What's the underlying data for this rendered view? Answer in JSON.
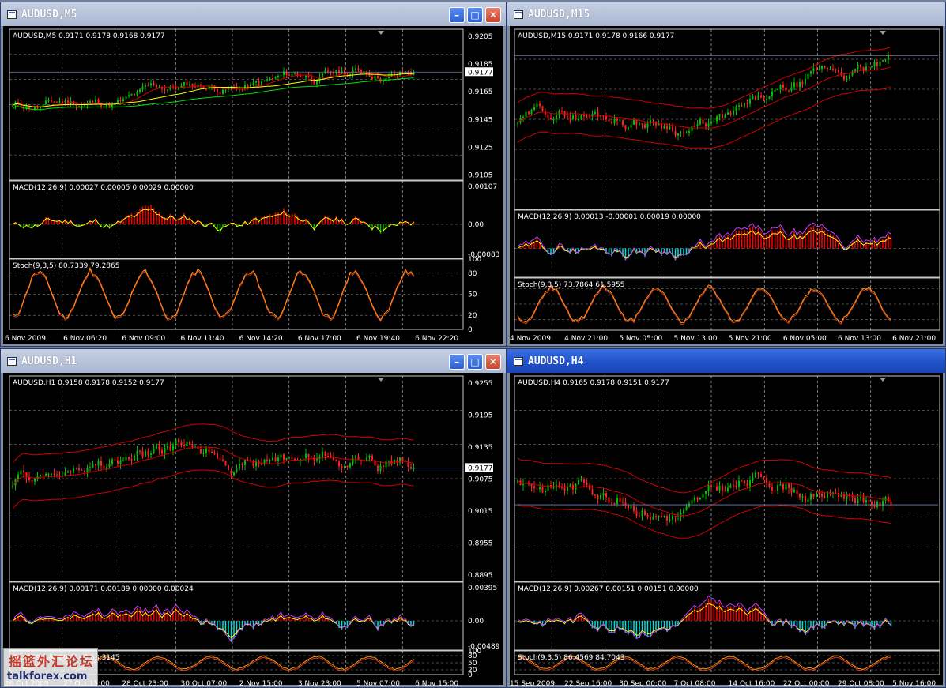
{
  "windows": [
    {
      "title": "AUDUSD,M5",
      "active": false,
      "show_buttons": true,
      "price_header": "AUDUSD,M5  0.9171 0.9178 0.9168 0.9177",
      "current_price": "0.9177",
      "price_ticks": [
        "0.9205",
        "0.9185",
        "0.9165",
        "0.9145",
        "0.9125",
        "0.9105"
      ],
      "macd_header": "MACD(12,26,9) 0.00027 0.00005 0.00029 0.00000",
      "macd_ticks": [
        "0.00107",
        "0.00",
        "-0.00083"
      ],
      "stoch_header": "Stoch(9,3,5) 80.7339 79.2865",
      "stoch_ticks": [
        "100",
        "80",
        "50",
        "20",
        "0"
      ],
      "time_labels": [
        "6 Nov 2009",
        "6 Nov 06:20",
        "6 Nov 09:00",
        "6 Nov 11:40",
        "6 Nov 14:20",
        "6 Nov 17:00",
        "6 Nov 19:40",
        "6 Nov 22:20"
      ],
      "bollinger": false
    },
    {
      "title": "AUDUSD,M15",
      "active": false,
      "show_buttons": false,
      "price_header": "AUDUSD,M15  0.9171 0.9178 0.9166 0.9177",
      "current_price": "",
      "price_ticks": [],
      "macd_header": "MACD(12,26,9) 0.00013 -0.00001 0.00019 0.00000",
      "macd_ticks": [],
      "stoch_header": "Stoch(9,3,5) 73.7864 61.5955",
      "stoch_ticks": [],
      "time_labels": [
        "4 Nov 2009",
        "4 Nov 21:00",
        "5 Nov 05:00",
        "5 Nov 13:00",
        "5 Nov 21:00",
        "6 Nov 05:00",
        "6 Nov 13:00",
        "6 Nov 21:00"
      ],
      "bollinger": true
    },
    {
      "title": "AUDUSD,H1",
      "active": false,
      "show_buttons": true,
      "price_header": "AUDUSD,H1  0.9158 0.9178 0.9152 0.9177",
      "current_price": "0.9177",
      "price_ticks": [
        "0.9255",
        "0.9195",
        "0.9135",
        "0.9075",
        "0.9015",
        "0.8955",
        "0.8895"
      ],
      "macd_header": "MACD(12,26,9) 0.00171 0.00189 0.00000 0.00024",
      "macd_ticks": [
        "0.00395",
        "0.00",
        "-0.00489"
      ],
      "stoch_header": "Stoch(9,3,5) 60.7143 63.3145",
      "stoch_ticks": [
        "100",
        "80",
        "50",
        "20",
        "0"
      ],
      "time_labels": [
        "26 Oct 2009",
        "27 Oct 15:00",
        "28 Oct 23:00",
        "30 Oct 07:00",
        "2 Nov 15:00",
        "3 Nov 23:00",
        "5 Nov 07:00",
        "6 Nov 15:00"
      ],
      "bollinger": true
    },
    {
      "title": "AUDUSD,H4",
      "active": true,
      "show_buttons": false,
      "price_header": "AUDUSD,H4  0.9165 0.9178 0.9151 0.9177",
      "current_price": "",
      "price_ticks": [],
      "macd_header": "MACD(12,26,9) 0.00267 0.00151 0.00151 0.00000",
      "macd_ticks": [],
      "stoch_header": "Stoch(9,3,5) 86.4569 84.7043",
      "stoch_ticks": [],
      "time_labels": [
        "15 Sep 2009",
        "22 Sep 16:00",
        "30 Sep 00:00",
        "7 Oct 08:00",
        "14 Oct 16:00",
        "22 Oct 00:00",
        "29 Oct 08:00",
        "5 Nov 16:00"
      ],
      "bollinger": true
    }
  ],
  "watermark": {
    "top_text": "摇篮外汇论坛",
    "bottom_text": "talkforex.com"
  },
  "colors": {
    "bull": "#00c000",
    "bear": "#ff2020",
    "ma_yellow": "#ffff00",
    "ma_green": "#00e000",
    "ma_red": "#d00000",
    "macd_red": "#ff0000",
    "macd_green": "#00c000",
    "macd_cyan": "#00e0e0",
    "stoch": "#ff9900",
    "grid": "#ffffff"
  }
}
